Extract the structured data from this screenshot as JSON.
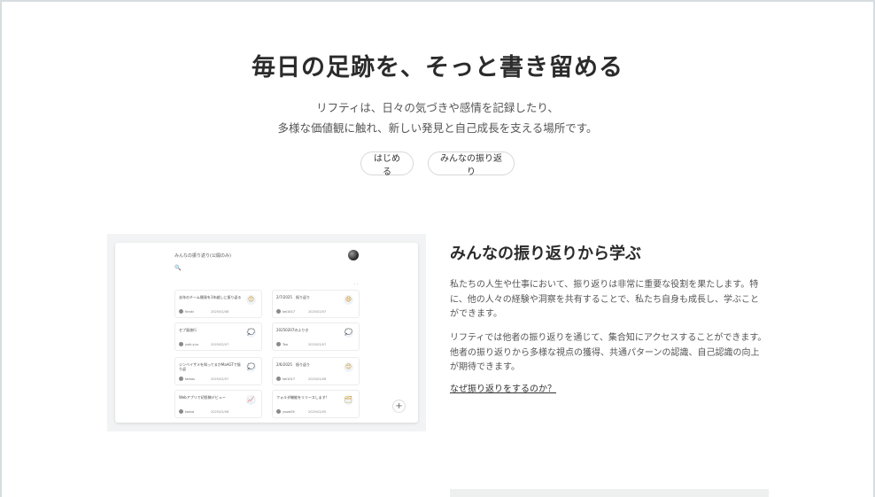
{
  "hero": {
    "title": "毎日の足跡を、そっと書き留める",
    "desc_line1": "リフティは、日々の気づきや感情を記録したり、",
    "desc_line2": "多様な価値観に触れ、新しい発見と自己成長を支える場所です。",
    "start_button": "はじめる",
    "everyone_button": "みんなの振り返り"
  },
  "preview": {
    "title": "みんなの振り返り(公開のみ)",
    "search_icon": "🔍",
    "more": "· ·",
    "add": "+",
    "cards": [
      {
        "text": "去年のチーム開発を1年越しに振り返る",
        "user": "hiroki",
        "date": "2025/02/08",
        "icon": "😊"
      },
      {
        "text": "2/7/2025　振り返り",
        "user": "kei1017",
        "date": "2025/02/07",
        "icon": "😄"
      },
      {
        "text": "セブ島旅行",
        "user": "yuki.yuu",
        "date": "2025/02/07",
        "icon": "💭"
      },
      {
        "text": "20250207のふりき",
        "user": "Tao",
        "date": "2025/02/07",
        "icon": "💭"
      },
      {
        "text": "ジンベイザメを知ってるかMaAGTで振り返",
        "user": "tamas",
        "date": "2025/02/07",
        "icon": "💭"
      },
      {
        "text": "2/6/2025　振り返り",
        "user": "kei1017",
        "date": "2025/02/06",
        "icon": "😊"
      },
      {
        "text": "Webアプリで初投稿デビュー",
        "user": "koinoi",
        "date": "2025/02/06",
        "icon": "📈"
      },
      {
        "text": "フォルダ機能をリリースします!",
        "user": "yusei05",
        "date": "2025/02/05",
        "icon": "🗂"
      }
    ]
  },
  "section": {
    "title": "みんなの振り返りから学ぶ",
    "para1": "私たちの人生や仕事において、振り返りは非常に重要な役割を果たします。特に、他の人々の経験や洞察を共有することで、私たち自身も成長し、学ぶことができます。",
    "para2": "リフティでは他者の振り返りを通じて、集合知にアクセスすることができます。他者の振り返りから多様な視点の獲得、共通パターンの認識、自己認識の向上が期待できます。",
    "link": "なぜ振り返りをするのか？"
  }
}
